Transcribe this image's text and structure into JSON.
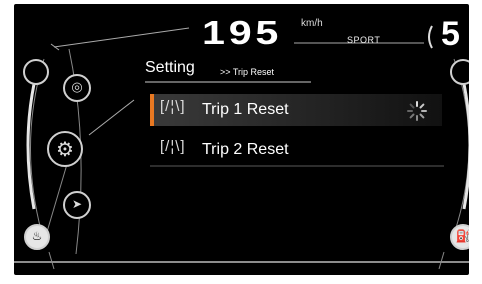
{
  "dashboard": {
    "speed": "195",
    "speed_unit": "km/h",
    "drive_mode": "SPORT",
    "gear": "5"
  },
  "menu": {
    "title": "Setting",
    "breadcrumb": ">> Trip Reset",
    "items": [
      {
        "icon": "[/¦\\]",
        "label": "Trip 1 Reset",
        "selected": true,
        "loading": true
      },
      {
        "icon": "[/¦\\]",
        "label": "Trip 2 Reset",
        "selected": false,
        "loading": false
      }
    ]
  },
  "colors": {
    "background": "#000000",
    "accent": "#e87822",
    "text": "#ffffff",
    "gauge_outline": "#d0d0d0"
  },
  "icons": [
    "camera-icon",
    "settings-gear-icon",
    "navigation-arrow-icon",
    "oil-temperature-icon",
    "fuel-pump-icon",
    "loading-spinner-icon"
  ]
}
